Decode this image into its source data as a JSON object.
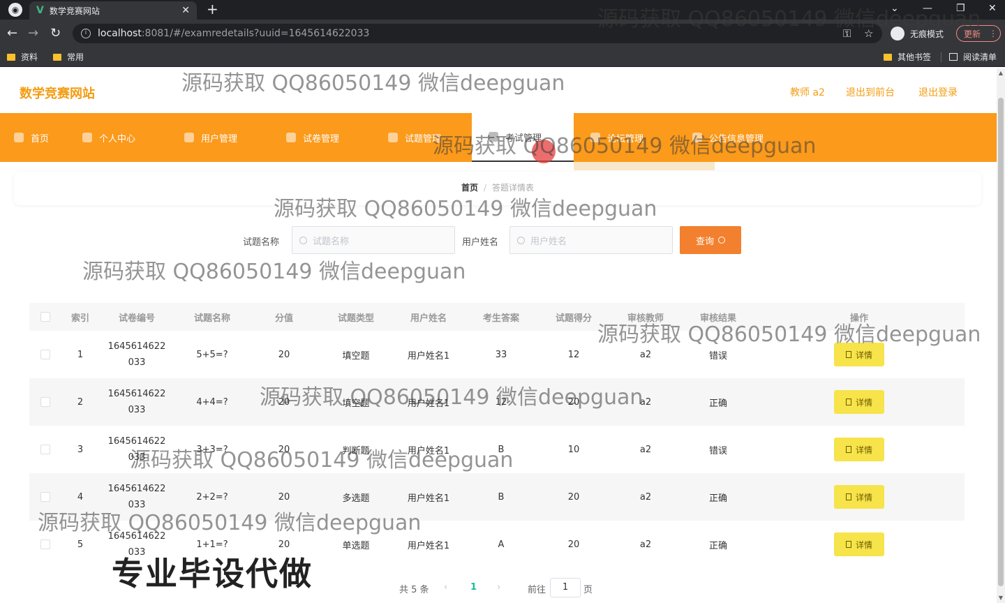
{
  "browser": {
    "tab_title": "数学竞赛网站",
    "favicon": "V",
    "url_host": "localhost",
    "url_path": ":8081/#/examredetails?uuid=1645614622033",
    "incognito_label": "无痕模式",
    "update_label": "更新",
    "bookmarks": [
      "资料",
      "常用"
    ],
    "bookmarks_right": [
      "其他书签",
      "阅读清单"
    ]
  },
  "site": {
    "logo": "数学竞赛网站",
    "header_links": [
      "教师 a2",
      "退出到前台",
      "退出登录"
    ],
    "nav": [
      "首页",
      "个人中心",
      "用户管理",
      "试卷管理",
      "试题管理",
      "考试管理",
      "论坛管理",
      "公告信息管理"
    ],
    "active_nav": "考试管理"
  },
  "breadcrumb": {
    "home": "首页",
    "separator": "/",
    "current": "答题详情表"
  },
  "search": {
    "question_label": "试题名称",
    "question_placeholder": "试题名称",
    "user_label": "用户姓名",
    "user_placeholder": "用户姓名",
    "button": "查询"
  },
  "table": {
    "columns": [
      "索引",
      "试卷编号",
      "试题名称",
      "分值",
      "试题类型",
      "用户姓名",
      "考生答案",
      "试题得分",
      "审核教师",
      "审核结果",
      "操作"
    ],
    "detail_label": "详情",
    "rows": [
      {
        "index": "1",
        "paper_id_1": "1645614622",
        "paper_id_2": "033",
        "question": "5+5=?",
        "score": "20",
        "type": "填空题",
        "user": "用户姓名1",
        "answer": "33",
        "got": "12",
        "teacher": "a2",
        "result": "错误"
      },
      {
        "index": "2",
        "paper_id_1": "1645614622",
        "paper_id_2": "033",
        "question": "4+4=?",
        "score": "20",
        "type": "填空题",
        "user": "用户姓名1",
        "answer": "12",
        "got": "20",
        "teacher": "a2",
        "result": "正确"
      },
      {
        "index": "3",
        "paper_id_1": "1645614622",
        "paper_id_2": "033",
        "question": "3+3=?",
        "score": "20",
        "type": "判断题",
        "user": "用户姓名1",
        "answer": "B",
        "got": "10",
        "teacher": "a2",
        "result": "错误"
      },
      {
        "index": "4",
        "paper_id_1": "1645614622",
        "paper_id_2": "033",
        "question": "2+2=?",
        "score": "20",
        "type": "多选题",
        "user": "用户姓名1",
        "answer": "B",
        "got": "20",
        "teacher": "a2",
        "result": "正确"
      },
      {
        "index": "5",
        "paper_id_1": "1645614622",
        "paper_id_2": "033",
        "question": "1+1=?",
        "score": "20",
        "type": "单选题",
        "user": "用户姓名1",
        "answer": "A",
        "got": "20",
        "teacher": "a2",
        "result": "正确"
      }
    ]
  },
  "pagination": {
    "total": "共 5 条",
    "prev": "‹",
    "current": "1",
    "next": "›",
    "goto": "前往",
    "goto_value": "1",
    "page_unit": "页"
  },
  "watermark": "源码获取 QQ86050149 微信deepguan",
  "promo": "专业毕设代做",
  "colors": {
    "nav_bg": "#fb9a1b",
    "brand": "#f39c12",
    "search_button": "#f2802e",
    "detail_button": "#f7e34a",
    "pager_active": "#1abc9c"
  }
}
